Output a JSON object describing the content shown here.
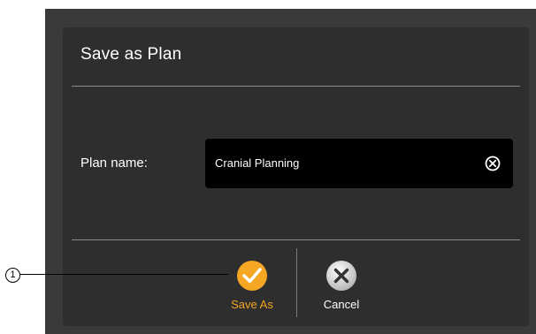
{
  "dialog": {
    "title": "Save as Plan",
    "field_label": "Plan name:",
    "plan_name_value": "Cranial Planning"
  },
  "actions": {
    "save_label": "Save As",
    "cancel_label": "Cancel"
  },
  "annotation": {
    "callout_number": "1"
  },
  "colors": {
    "accent": "#f5a623",
    "dialog_bg": "#2e2e2e",
    "frame_bg": "#3a3a3a",
    "input_bg": "#000000"
  },
  "icons": {
    "clear": "clear-icon",
    "save": "checkmark-circle-icon",
    "cancel": "x-circle-icon"
  }
}
